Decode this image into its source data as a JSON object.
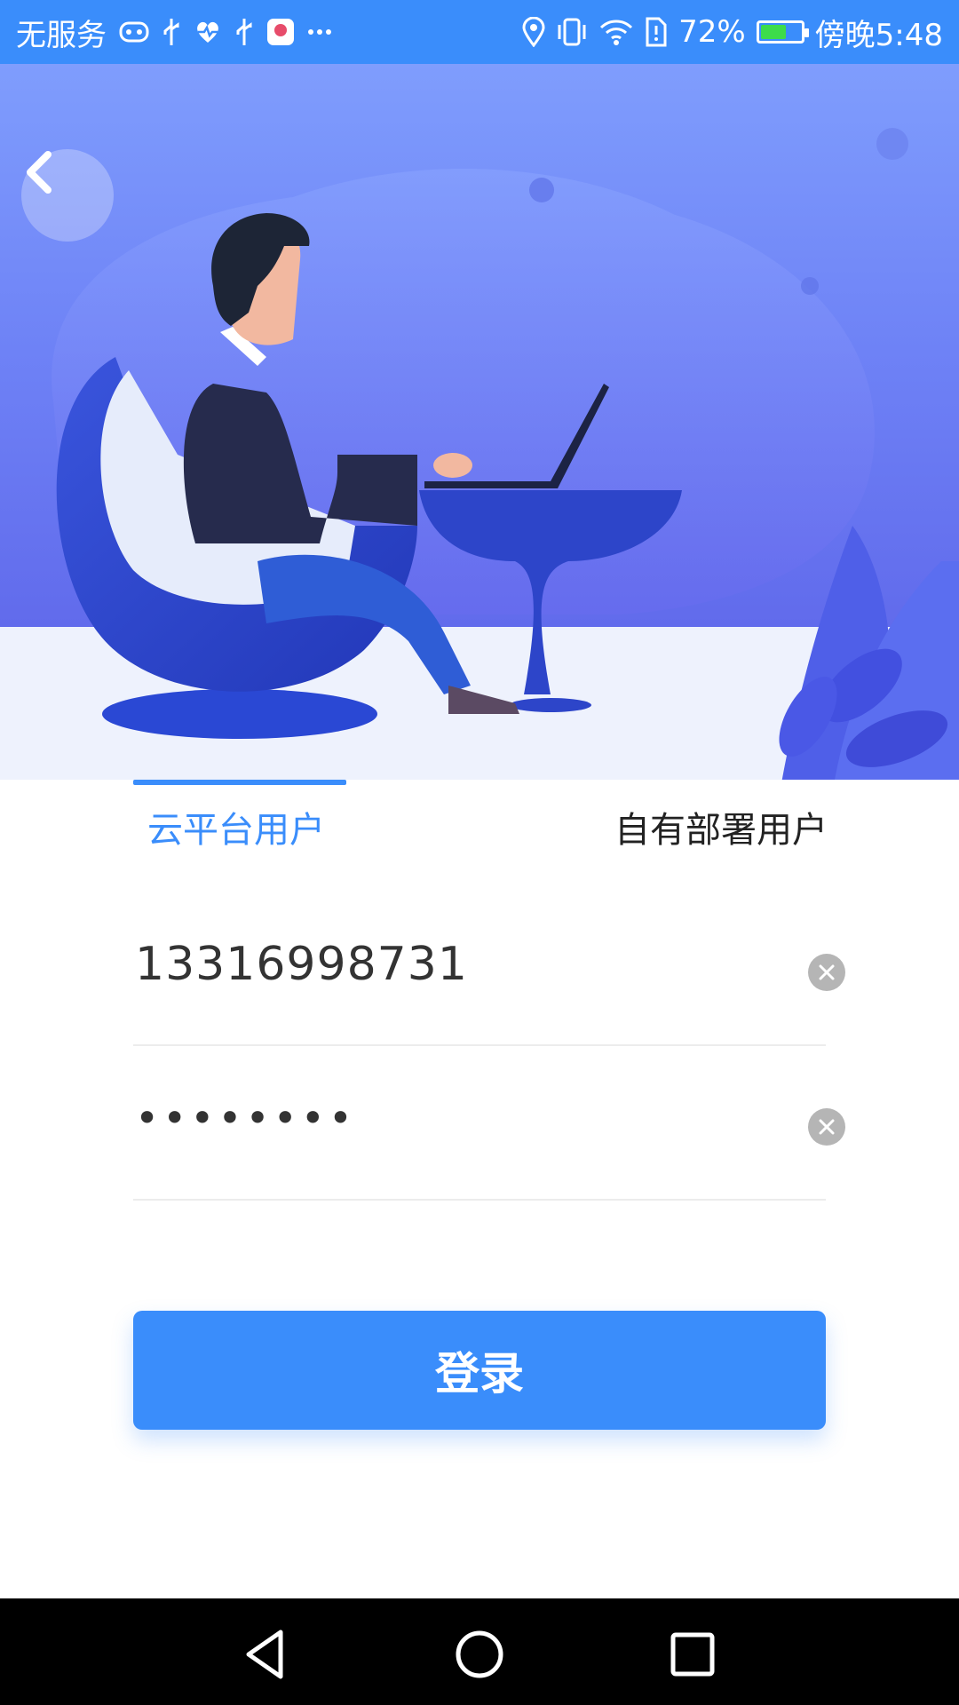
{
  "status_bar": {
    "carrier": "无服务",
    "battery_percent": "72%",
    "time": "傍晚5:48",
    "battery_level": 0.72,
    "icons": [
      "vr-icon",
      "usb-icon",
      "health-icon",
      "usb-icon",
      "app-icon",
      "more-icon",
      "location-icon",
      "vibrate-icon",
      "wifi-icon",
      "sim-alert-icon",
      "battery-icon"
    ]
  },
  "hero": {
    "back_icon": "chevron-left-icon",
    "illustration": "person-with-laptop-illustration"
  },
  "tabs": [
    {
      "label": "云平台用户",
      "active": true
    },
    {
      "label": "自有部署用户",
      "active": false
    }
  ],
  "form": {
    "phone_value": "13316998731",
    "password_value": "••••••••",
    "clear_icon": "clear-circle-icon"
  },
  "login_label": "登录",
  "nav_bar": {
    "back_icon": "nav-back-icon",
    "home_icon": "nav-home-icon",
    "recents_icon": "nav-recents-icon"
  },
  "colors": {
    "accent": "#3a8dfb",
    "hero_top": "#7f9dfd",
    "hero_bottom": "#5a5ee6"
  }
}
